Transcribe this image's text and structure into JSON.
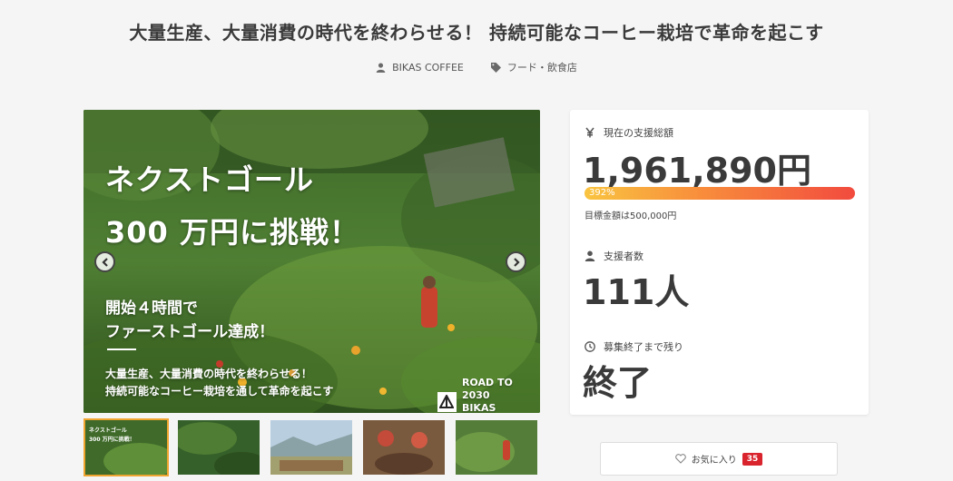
{
  "project": {
    "title": "大量生産、大量消費の時代を終わらせる！ 持続可能なコーヒー栽培で革命を起こす",
    "owner": "BIKAS COFFEE",
    "category": "フード・飲食店"
  },
  "hero": {
    "line1": "ネクストゴール",
    "line2": "300 万円に挑戦！",
    "line3": "開始４時間で",
    "line4": "ファーストゴール達成！",
    "line5": "大量生産、大量消費の時代を終わらせる！",
    "line6": "持続可能なコーヒー栽培を通して革命を起こす",
    "badge_line1": "ROAD TO 2030",
    "badge_line2": "BIKAS COFFEE"
  },
  "stats": {
    "total_label": "現在の支援総額",
    "total_value": "1,961,890円",
    "progress_percent": "392%",
    "progress_fraction": 1.0,
    "goal_text": "目標金額は500,000円",
    "supporters_label": "支援者数",
    "supporters_value": "111人",
    "remaining_label": "募集終了まで残り",
    "remaining_value": "終了"
  },
  "favorite": {
    "label": "お気に入り",
    "count": "35"
  },
  "colors": {
    "accent_red": "#d9232d",
    "progress_start": "#f9c440",
    "progress_end": "#f24b3e",
    "thumb_active": "#f0a531"
  },
  "icons": [
    "user-icon",
    "tag-icon",
    "yen-icon",
    "supporters-icon",
    "clock-icon",
    "heart-icon",
    "chevron-left-icon",
    "chevron-right-icon"
  ]
}
